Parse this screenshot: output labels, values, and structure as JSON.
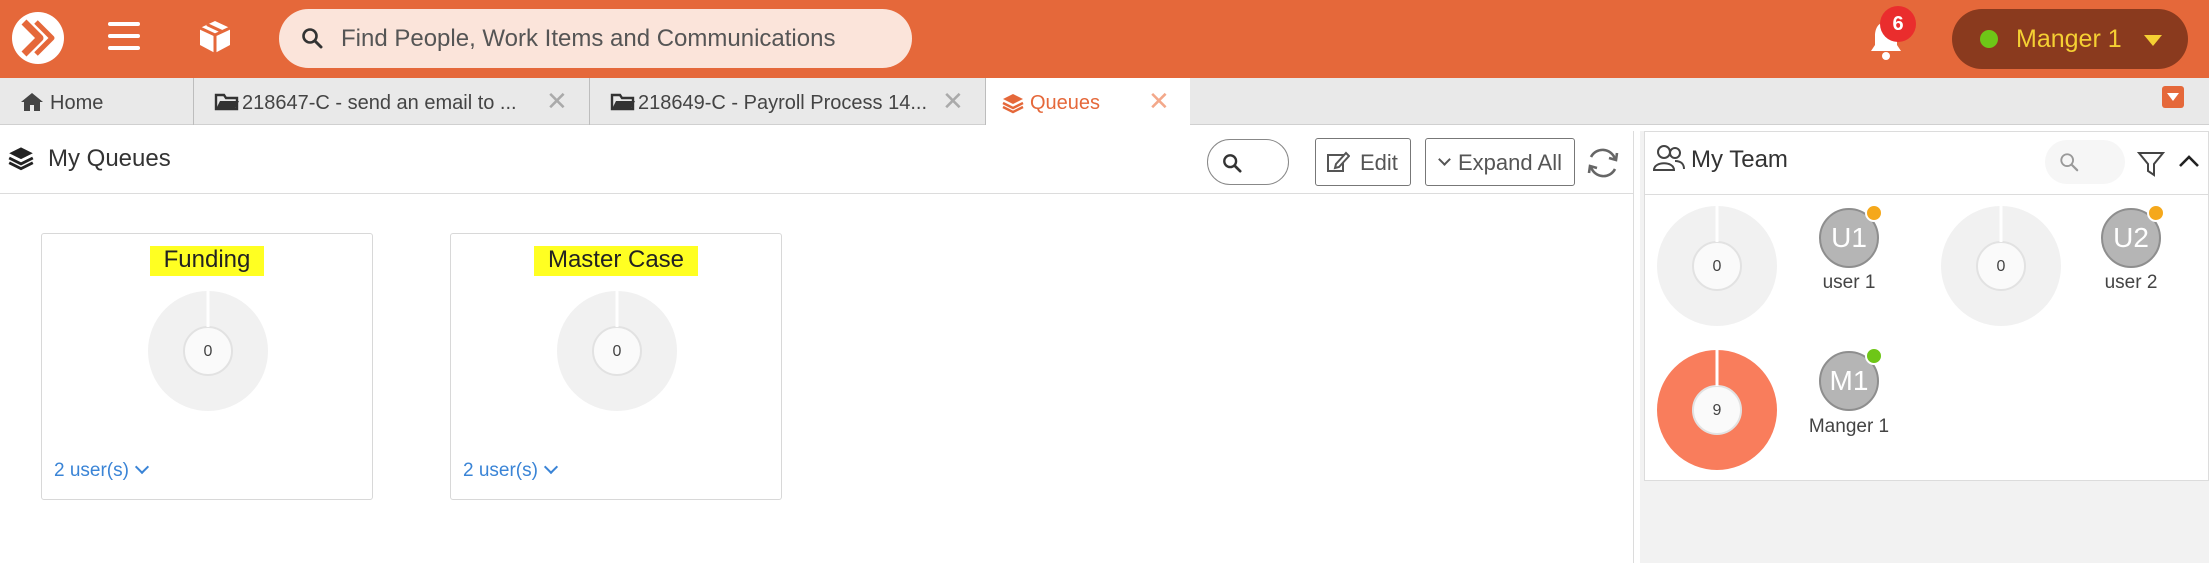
{
  "app": {
    "search_placeholder": "Find People, Work Items and Communications",
    "notifications_count": "6",
    "user_name": "Manger 1",
    "colors": {
      "brand": "#e5683a",
      "user_status": "#6ec617",
      "badge": "#ea2d2d",
      "highlight": "#ffff22",
      "link": "#3a84d6"
    }
  },
  "tabs": [
    {
      "label": "Home",
      "icon": "home-icon",
      "closable": false,
      "active": false
    },
    {
      "label": "218647-C - send an email to ...",
      "icon": "folder-icon",
      "closable": true,
      "active": false
    },
    {
      "label": "218649-C - Payroll Process 14...",
      "icon": "folder-icon",
      "closable": true,
      "active": false
    },
    {
      "label": "Queues",
      "icon": "layers-icon",
      "closable": true,
      "active": true
    }
  ],
  "queues_panel": {
    "title": "My Queues",
    "edit_label": "Edit",
    "expand_label": "Expand All",
    "cards": [
      {
        "title": "Funding",
        "count": "0",
        "users_link": "2 user(s)"
      },
      {
        "title": "Master Case",
        "count": "0",
        "users_link": "2 user(s)"
      }
    ]
  },
  "team_panel": {
    "title": "My Team",
    "members": [
      {
        "initials": "U1",
        "name": "user 1",
        "count": "0",
        "status_color": "#f5a81b",
        "load": 0
      },
      {
        "initials": "U2",
        "name": "user 2",
        "count": "0",
        "status_color": "#f5a81b",
        "load": 0
      },
      {
        "initials": "M1",
        "name": "Manger 1",
        "count": "9",
        "status_color": "#6ec617",
        "load": 1
      }
    ]
  }
}
